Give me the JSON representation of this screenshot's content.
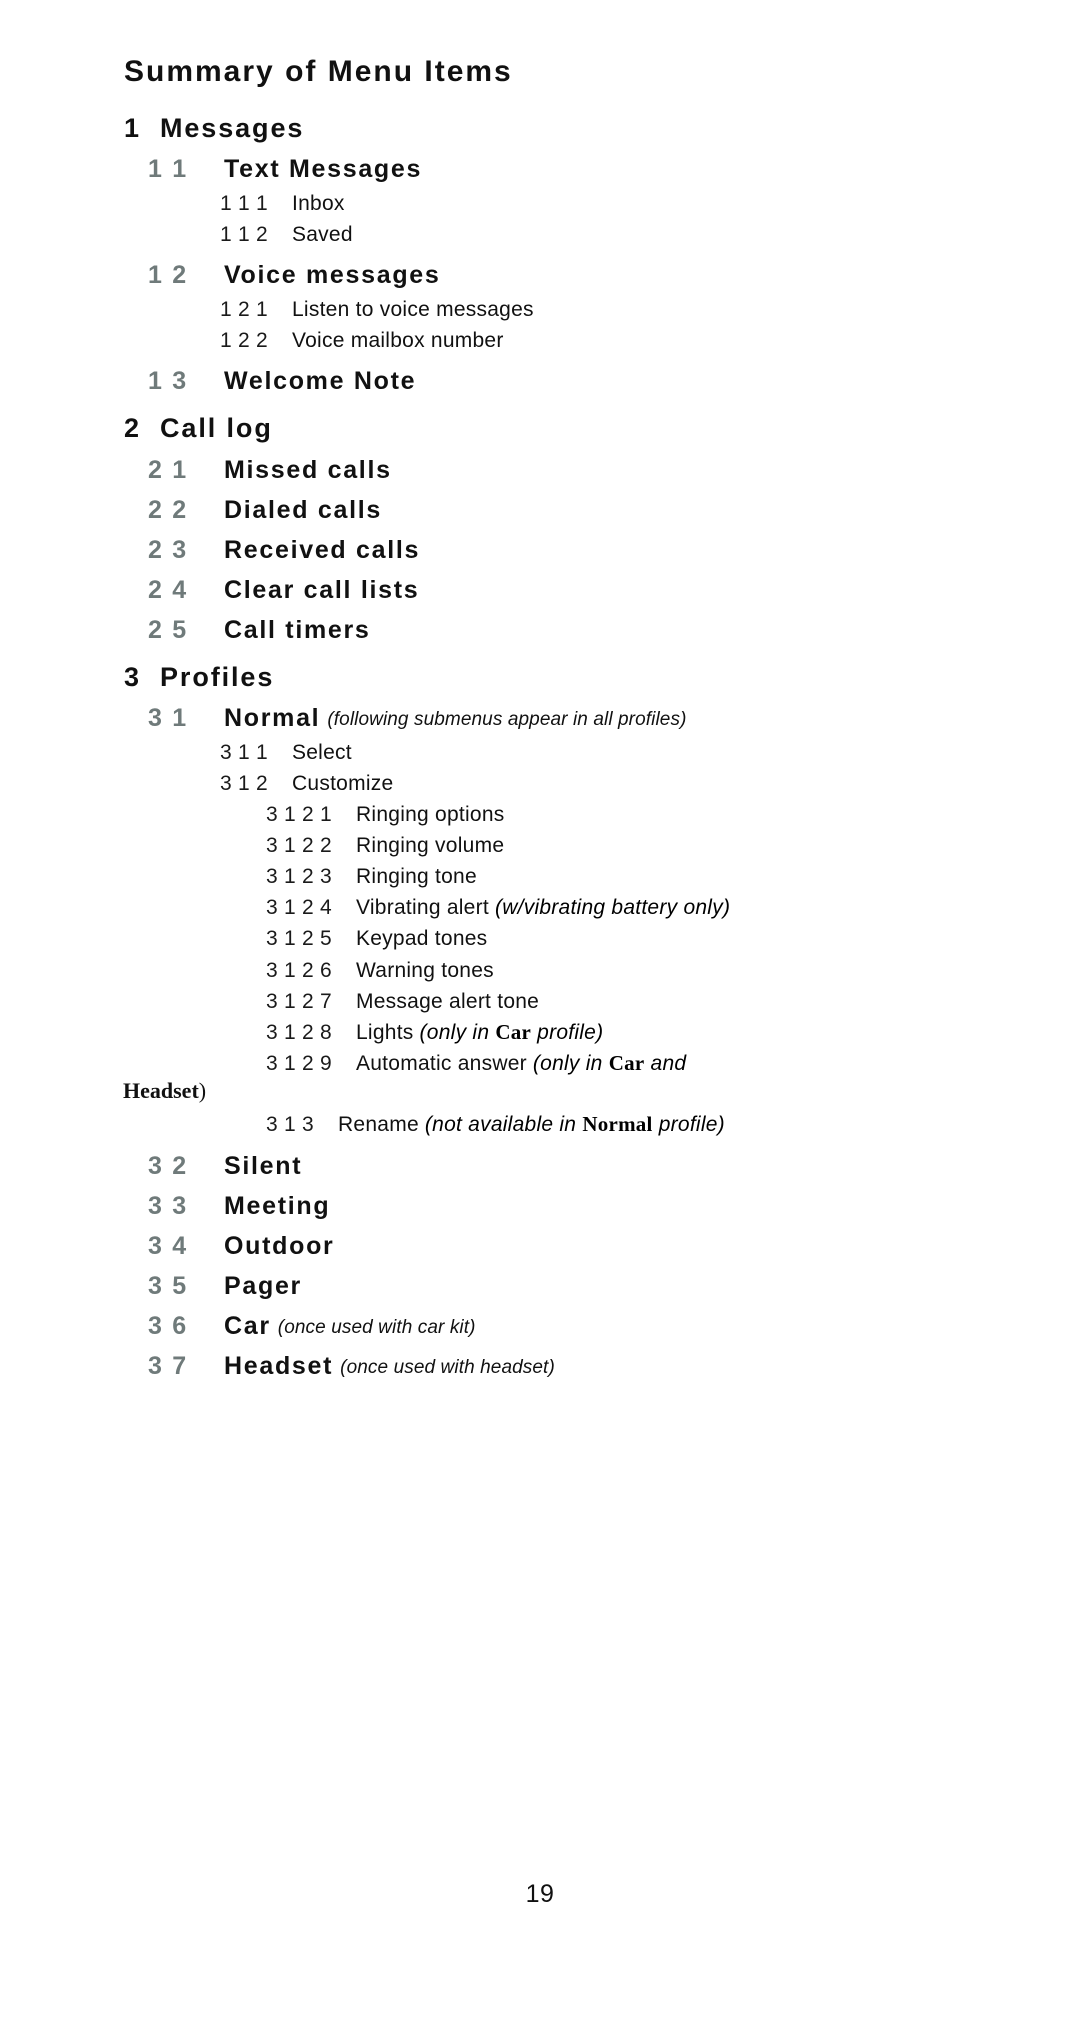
{
  "document": {
    "title": "Summary of Menu Items",
    "page_number": "19"
  },
  "sections": {
    "messages": {
      "num": "1",
      "label": "Messages",
      "text_messages": {
        "num": "1 1",
        "label": "Text Messages",
        "inbox": {
          "num": "1 1 1",
          "label": "Inbox"
        },
        "saved": {
          "num": "1 1 2",
          "label": "Saved"
        }
      },
      "voice_messages": {
        "num": "1 2",
        "label": "Voice messages",
        "listen": {
          "num": "1 2 1",
          "label": "Listen to voice messages"
        },
        "mailbox": {
          "num": "1 2 2",
          "label": "Voice mailbox number"
        }
      },
      "welcome_note": {
        "num": "1 3",
        "label": "Welcome Note"
      }
    },
    "call_log": {
      "num": "2",
      "label": "Call log",
      "missed": {
        "num": "2 1",
        "label": "Missed calls"
      },
      "dialed": {
        "num": "2 2",
        "label": "Dialed calls"
      },
      "received": {
        "num": "2 3",
        "label": "Received calls"
      },
      "clear": {
        "num": "2 4",
        "label": "Clear call lists"
      },
      "timers": {
        "num": "2 5",
        "label": "Call timers"
      }
    },
    "profiles": {
      "num": "3",
      "label": "Profiles",
      "normal": {
        "num": "3 1",
        "label": "Normal",
        "note": "(following submenus appear in all profiles)",
        "select": {
          "num": "3 1 1",
          "label": "Select"
        },
        "customize": {
          "num": "3 1 2",
          "label": "Customize",
          "ringing_options": {
            "num": "3 1 2 1",
            "label": "Ringing options"
          },
          "ringing_volume": {
            "num": "3 1 2 2",
            "label": "Ringing volume"
          },
          "ringing_tone": {
            "num": "3 1 2 3",
            "label": "Ringing tone"
          },
          "vibrating_alert": {
            "num": "3 1 2 4",
            "label": "Vibrating alert",
            "note": "(w/vibrating battery only)"
          },
          "keypad_tones": {
            "num": "3 1 2 5",
            "label": "Keypad tones"
          },
          "warning_tones": {
            "num": "3 1 2 6",
            "label": "Warning tones"
          },
          "message_alert_tone": {
            "num": "3 1 2 7",
            "label": "Message alert tone"
          },
          "lights": {
            "num": "3 1 2 8",
            "label": "Lights",
            "note_pre": "(only in ",
            "note_bold": "Car",
            "note_post": " profile)"
          },
          "automatic_answer": {
            "num": "3 1 2 9",
            "label": "Automatic answer",
            "note_pre": "(only in ",
            "note_bold1": "Car",
            "note_mid": " and",
            "note_bold2": "Headset",
            "note_post": ")"
          }
        },
        "rename": {
          "num": "3 1 3",
          "label": "Rename",
          "note_pre": "(not available in ",
          "note_bold": "Normal",
          "note_post": " profile)"
        }
      },
      "silent": {
        "num": "3 2",
        "label": "Silent"
      },
      "meeting": {
        "num": "3 3",
        "label": "Meeting"
      },
      "outdoor": {
        "num": "3 4",
        "label": "Outdoor"
      },
      "pager": {
        "num": "3 5",
        "label": "Pager"
      },
      "car": {
        "num": "3 6",
        "label": "Car",
        "note": "(once used with car kit)"
      },
      "headset": {
        "num": "3 7",
        "label": "Headset",
        "note": "(once used with headset)"
      }
    }
  }
}
